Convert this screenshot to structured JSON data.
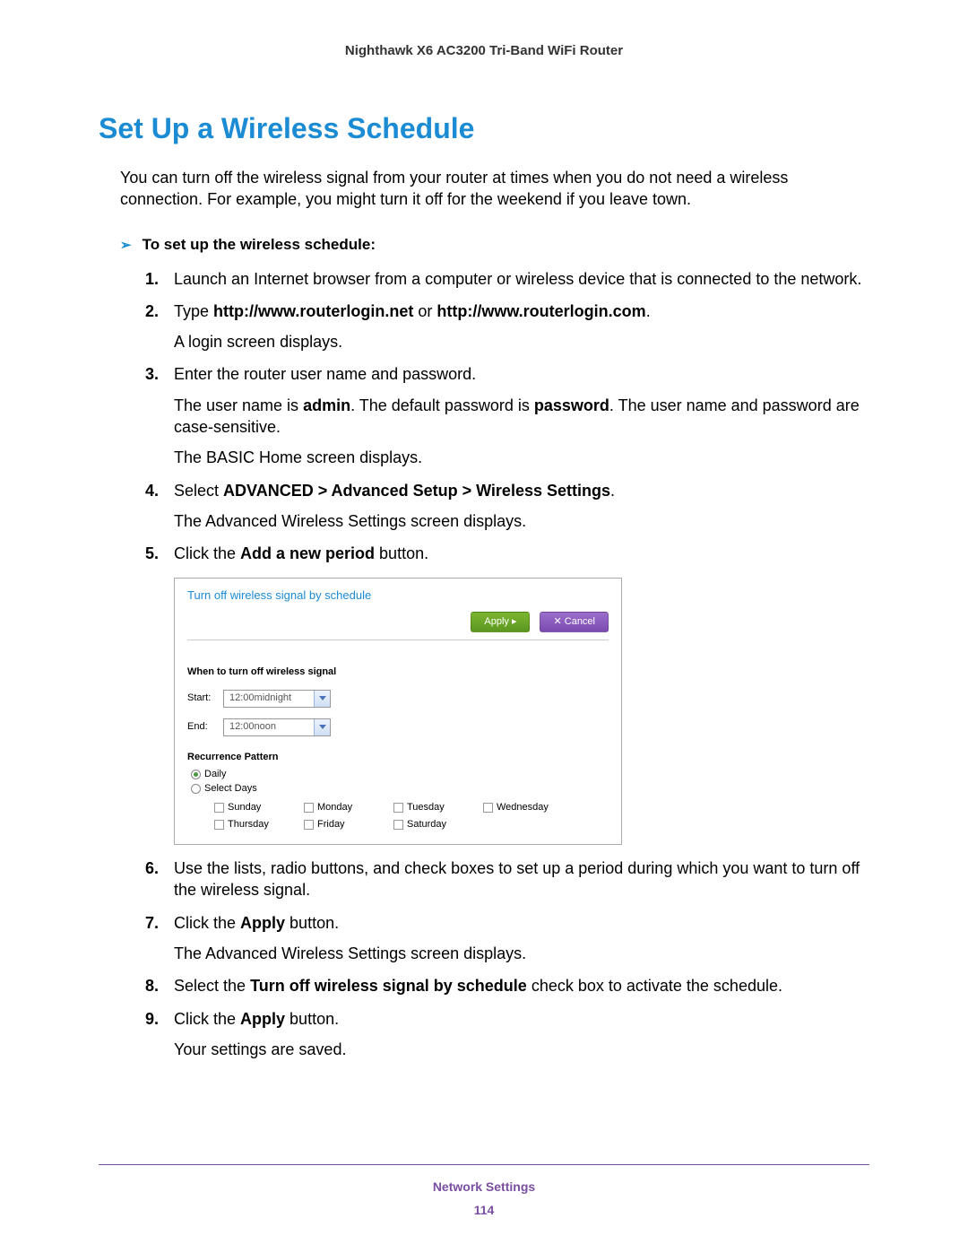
{
  "header": {
    "product": "Nighthawk X6 AC3200 Tri-Band WiFi Router"
  },
  "title": "Set Up a Wireless Schedule",
  "intro": "You can turn off the wireless signal from your router at times when you do not need a wireless connection. For example, you might turn it off for the weekend if you leave town.",
  "proc_heading": "To set up the wireless schedule:",
  "steps": {
    "s1": "Launch an Internet browser from a computer or wireless device that is connected to the network.",
    "s2_pre": "Type ",
    "s2_b1": "http://www.routerlogin.net",
    "s2_mid": " or ",
    "s2_b2": "http://www.routerlogin.com",
    "s2_post": ".",
    "s2_p1": "A login screen displays.",
    "s3": "Enter the router user name and password.",
    "s3_p1a": "The user name is ",
    "s3_p1b": "admin",
    "s3_p1c": ". The default password is ",
    "s3_p1d": "password",
    "s3_p1e": ". The user name and password are case-sensitive.",
    "s3_p2": "The BASIC Home screen displays.",
    "s4_pre": "Select ",
    "s4_b": "ADVANCED > Advanced Setup > Wireless Settings",
    "s4_post": ".",
    "s4_p1": "The Advanced Wireless Settings screen displays.",
    "s5_pre": "Click the ",
    "s5_b": "Add a new period",
    "s5_post": " button.",
    "s6": "Use the lists, radio buttons, and check boxes to set up a period during which you want to turn off the wireless signal.",
    "s7_pre": "Click the ",
    "s7_b": "Apply",
    "s7_post": " button.",
    "s7_p1": "The Advanced Wireless Settings screen displays.",
    "s8_pre": "Select the ",
    "s8_b": "Turn off wireless signal by schedule",
    "s8_post": " check box to activate the schedule.",
    "s9_pre": "Click the ",
    "s9_b": "Apply",
    "s9_post": " button.",
    "s9_p1": "Your settings are saved."
  },
  "screenshot": {
    "title": "Turn off wireless signal by schedule",
    "apply": "Apply ▸",
    "cancel": "✕ Cancel",
    "section": "When to turn off wireless signal",
    "start_label": "Start:",
    "start_value": "12:00midnight",
    "end_label": "End:",
    "end_value": "12:00noon",
    "recur_label": "Recurrence Pattern",
    "daily": "Daily",
    "select_days": "Select Days",
    "days": {
      "sun": "Sunday",
      "mon": "Monday",
      "tue": "Tuesday",
      "wed": "Wednesday",
      "thu": "Thursday",
      "fri": "Friday",
      "sat": "Saturday"
    }
  },
  "footer": {
    "section": "Network Settings",
    "page": "114"
  }
}
